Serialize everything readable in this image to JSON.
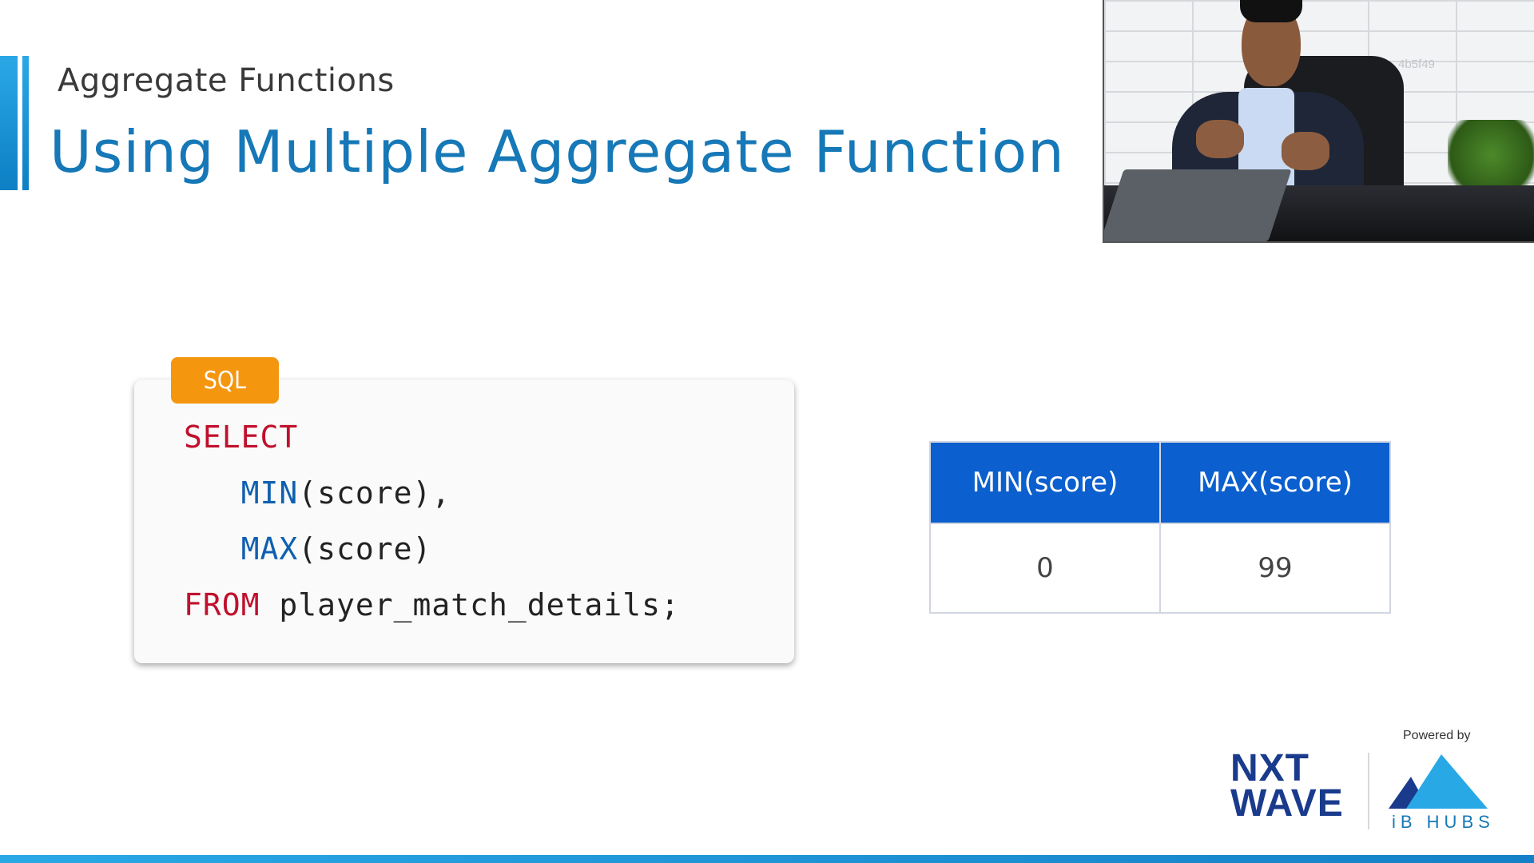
{
  "slide": {
    "subtitle": "Aggregate Functions",
    "title": "Using Multiple Aggregate Function"
  },
  "video": {
    "overlay_code": "4b5f49"
  },
  "code_block": {
    "language": "SQL",
    "lines": [
      {
        "keyword": "SELECT",
        "rest": ""
      },
      {
        "func": "MIN",
        "rest": "(score),"
      },
      {
        "func": "MAX",
        "rest": "(score)"
      },
      {
        "keyword": "FROM",
        "rest": " player_match_details;"
      }
    ]
  },
  "result_table": {
    "headers": [
      "MIN(score)",
      "MAX(score)"
    ],
    "rows": [
      [
        "0",
        "99"
      ]
    ]
  },
  "branding": {
    "powered_by": "Powered by",
    "nxt_line1": "NXT",
    "nxt_line2": "WAVE",
    "ib_hubs": "iB HUBS"
  },
  "colors": {
    "title": "#1678b7",
    "badge": "#f5960f",
    "table_header": "#0b5fce",
    "keyword": "#c0102c",
    "function": "#1060b0"
  }
}
